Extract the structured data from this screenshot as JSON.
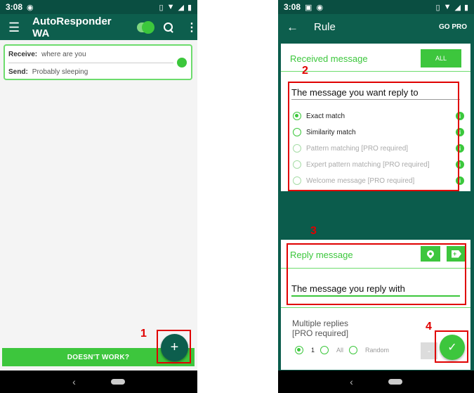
{
  "left": {
    "status": {
      "time": "3:08"
    },
    "app_title": "AutoResponder WA",
    "rule": {
      "receive_label": "Receive:",
      "receive_value": "where are you",
      "send_label": "Send:",
      "send_value": "Probably sleeping"
    },
    "bottom_button": "DOESN'T WORK?",
    "fab_symbol": "+",
    "annotation": "1"
  },
  "right": {
    "status": {
      "time": "3:08"
    },
    "title": "Rule",
    "go_pro": "GO PRO",
    "received_title": "Received message",
    "all_button": "ALL",
    "message_input": "The message you want reply to",
    "match_options": [
      {
        "label": "Exact match",
        "selected": true,
        "enabled": true
      },
      {
        "label": "Similarity match",
        "selected": false,
        "enabled": true
      },
      {
        "label": "Pattern matching [PRO required]",
        "selected": false,
        "enabled": false
      },
      {
        "label": "Expert pattern matching [PRO required]",
        "selected": false,
        "enabled": false
      },
      {
        "label": "Welcome message [PRO required]",
        "selected": false,
        "enabled": false
      }
    ],
    "reply_title": "Reply message",
    "reply_input": "The message you reply with",
    "multiple_replies": "Multiple replies",
    "pro_required": "[PRO required]",
    "reply_options": [
      "1",
      "All",
      "Random"
    ],
    "minus": "-",
    "annotations": [
      "2",
      "3",
      "4"
    ]
  },
  "colors": {
    "primary_dark": "#0b5c4c",
    "accent_green": "#3dc63d",
    "annotation_red": "#e00000"
  }
}
